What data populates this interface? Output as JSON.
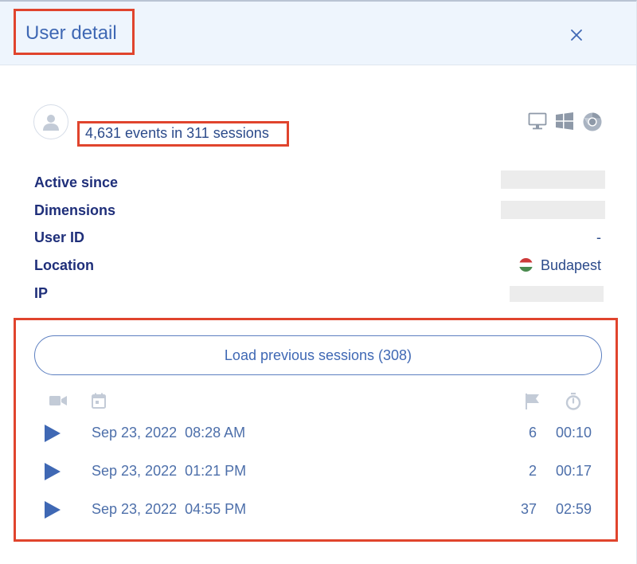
{
  "header": {
    "title": "User detail",
    "close_icon": "close-icon"
  },
  "summary": {
    "text": "4,631 events in 311 sessions",
    "avatar_icon": "user-avatar-icon",
    "platform_icons": [
      "desktop-icon",
      "windows-icon",
      "chrome-icon"
    ]
  },
  "fields": [
    {
      "label": "Active since",
      "value": ""
    },
    {
      "label": "Dimensions",
      "value": ""
    },
    {
      "label": "User ID",
      "value": "-"
    },
    {
      "label": "Location",
      "value": "Budapest"
    },
    {
      "label": "IP",
      "value": ""
    }
  ],
  "sessions": {
    "load_label": "Load previous sessions (308)",
    "column_icons": [
      "video-camera-icon",
      "calendar-icon",
      "flag-icon",
      "stopwatch-icon"
    ],
    "rows": [
      {
        "date": "Sep 23, 2022  08:28 AM",
        "events": "6",
        "duration": "00:10"
      },
      {
        "date": "Sep 23, 2022  01:21 PM",
        "events": "2",
        "duration": "00:17"
      },
      {
        "date": "Sep 23, 2022  04:55 PM",
        "events": "37",
        "duration": "02:59"
      }
    ]
  },
  "colors": {
    "accent": "#3f68b4",
    "label": "#1f2f7a",
    "highlight": "#e0442d",
    "header_bg": "#eef5fd"
  }
}
